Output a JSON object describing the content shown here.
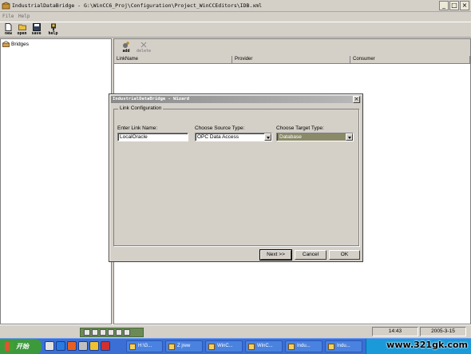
{
  "window": {
    "title": "IndustrialDataBridge - G:\\WinCC6_Proj\\Configuration\\Project_WinCCEditors\\IDB.xml",
    "controls": [
      "_",
      "□",
      "×"
    ]
  },
  "menu": [
    "File",
    "Help"
  ],
  "toolbar": [
    {
      "label": "new",
      "icon": "new-file-icon"
    },
    {
      "label": "open",
      "icon": "open-folder-icon"
    },
    {
      "label": "save",
      "icon": "save-disk-icon"
    },
    {
      "label": "help",
      "icon": "help-icon"
    }
  ],
  "tree": {
    "root_label": "Bridges",
    "icon": "bridges-icon"
  },
  "right_toolbar": {
    "add_label": "add",
    "delete_label": "delete"
  },
  "columns": [
    "LinkName",
    "Provider",
    "Consumer"
  ],
  "dialog": {
    "title": "IndustrialDataBridge - Wizard",
    "group_title": "Link Configuration",
    "link_name_label": "Enter Link Name:",
    "link_name_value": "LocalOracle",
    "source_label": "Choose Source Type:",
    "source_value": "OPC Data Access",
    "target_label": "Choose Target Type:",
    "target_value": "Database",
    "buttons": {
      "next": "Next >>",
      "cancel": "Cancel",
      "ok": "OK"
    }
  },
  "status": {
    "time": "14:43",
    "date": "2005-3-15"
  },
  "taskbar": {
    "start_label": "开始",
    "tasks": [
      "H:\\G...",
      "Z jrew",
      "WinC...",
      "WinC...",
      "Indu...",
      "Indu..."
    ],
    "watermark": "www.321gk.com"
  },
  "colors": {
    "taskbar": "#3b6fd6",
    "start": "#3c9a3c",
    "dialog_title": "#8a8a8a"
  }
}
